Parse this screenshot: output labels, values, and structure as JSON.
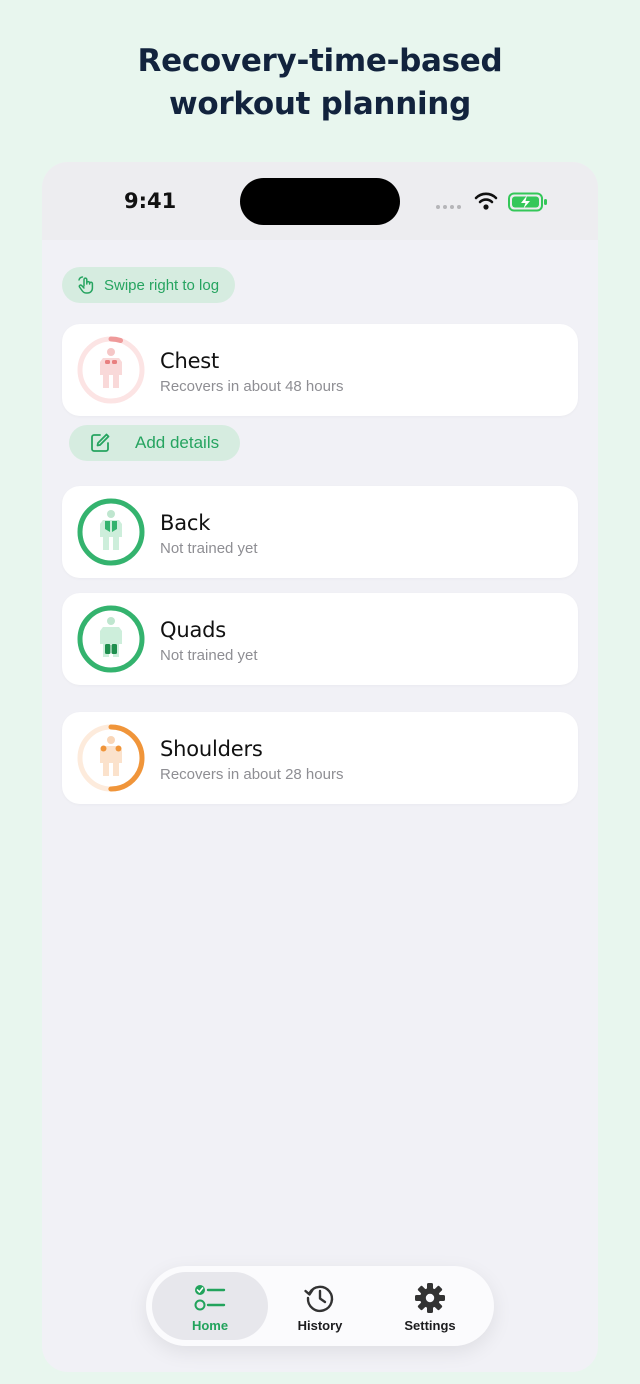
{
  "headline": {
    "line1": "Recovery-time-based",
    "line2": "workout planning"
  },
  "status_bar": {
    "time": "9:41"
  },
  "hint": {
    "label": "Swipe right to log"
  },
  "muscles": [
    {
      "name": "Chest",
      "status": "Recovers in about 48 hours",
      "recovery_fraction": 0.05,
      "color": "#ef9a9a"
    },
    {
      "name": "Back",
      "status": "Not trained yet",
      "recovery_fraction": 1.0,
      "color": "#34b36e"
    },
    {
      "name": "Quads",
      "status": "Not trained yet",
      "recovery_fraction": 1.0,
      "color": "#34b36e"
    },
    {
      "name": "Shoulders",
      "status": "Recovers in about 28 hours",
      "recovery_fraction": 0.5,
      "color": "#f0953a"
    }
  ],
  "add_details": {
    "label": "Add details"
  },
  "tabs": [
    {
      "label": "Home",
      "icon": "checklist-icon",
      "active": true
    },
    {
      "label": "History",
      "icon": "clock-history-icon",
      "active": false
    },
    {
      "label": "Settings",
      "icon": "gear-icon",
      "active": false
    }
  ],
  "colors": {
    "accent": "#26a460",
    "background": "#e8f6ee",
    "title": "#12233d"
  }
}
